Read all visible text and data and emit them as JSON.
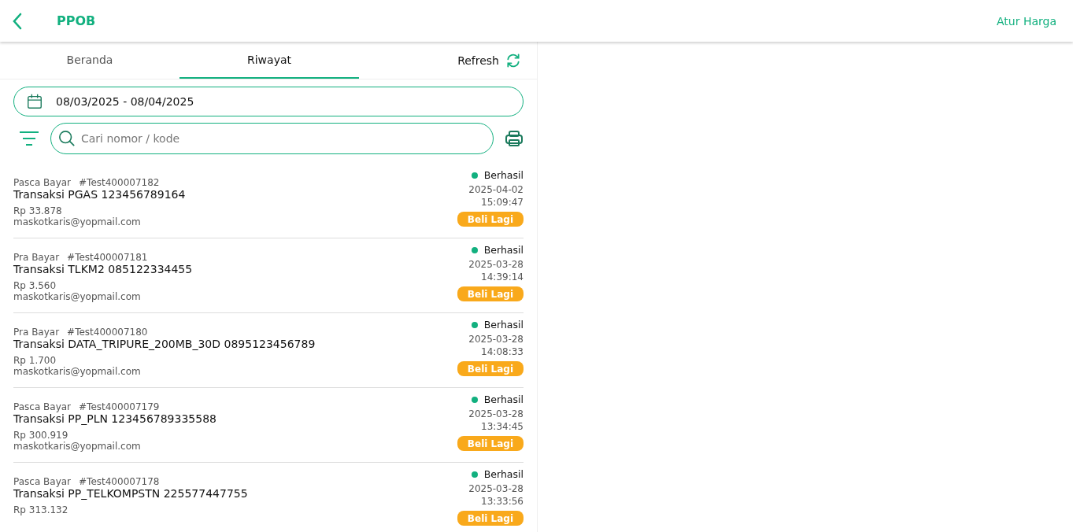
{
  "header": {
    "title": "PPOB",
    "action": "Atur Harga"
  },
  "tabs": [
    {
      "label": "Beranda",
      "selected": false
    },
    {
      "label": "Riwayat",
      "selected": true
    }
  ],
  "refresh": {
    "label": "Refresh"
  },
  "date_range": {
    "value": "08/03/2025 - 08/04/2025"
  },
  "search": {
    "placeholder": "Cari nomor / kode"
  },
  "transactions": [
    {
      "type": "Pasca Bayar",
      "code": "#Test400007182",
      "title": "Transaksi PGAS 123456789164",
      "amount": "Rp 33.878",
      "email": "maskotkaris@yopmail.com",
      "status": "Berhasil",
      "date": "2025-04-02",
      "time": "15:09:47",
      "action": "Beli Lagi"
    },
    {
      "type": "Pra Bayar",
      "code": "#Test400007181",
      "title": "Transaksi TLKM2 085122334455",
      "amount": "Rp 3.560",
      "email": "maskotkaris@yopmail.com",
      "status": "Berhasil",
      "date": "2025-03-28",
      "time": "14:39:14",
      "action": "Beli Lagi"
    },
    {
      "type": "Pra Bayar",
      "code": "#Test400007180",
      "title": "Transaksi DATA_TRIPURE_200MB_30D 0895123456789",
      "amount": "Rp 1.700",
      "email": "maskotkaris@yopmail.com",
      "status": "Berhasil",
      "date": "2025-03-28",
      "time": "14:08:33",
      "action": "Beli Lagi"
    },
    {
      "type": "Pasca Bayar",
      "code": "#Test400007179",
      "title": "Transaksi PP_PLN 123456789335588",
      "amount": "Rp 300.919",
      "email": "maskotkaris@yopmail.com",
      "status": "Berhasil",
      "date": "2025-03-28",
      "time": "13:34:45",
      "action": "Beli Lagi"
    },
    {
      "type": "Pasca Bayar",
      "code": "#Test400007178",
      "title": "Transaksi PP_TELKOMPSTN 225577447755",
      "amount": "Rp 313.132",
      "status": "Berhasil",
      "date": "2025-03-28",
      "time": "13:33:56",
      "action": "Beli Lagi"
    }
  ]
}
